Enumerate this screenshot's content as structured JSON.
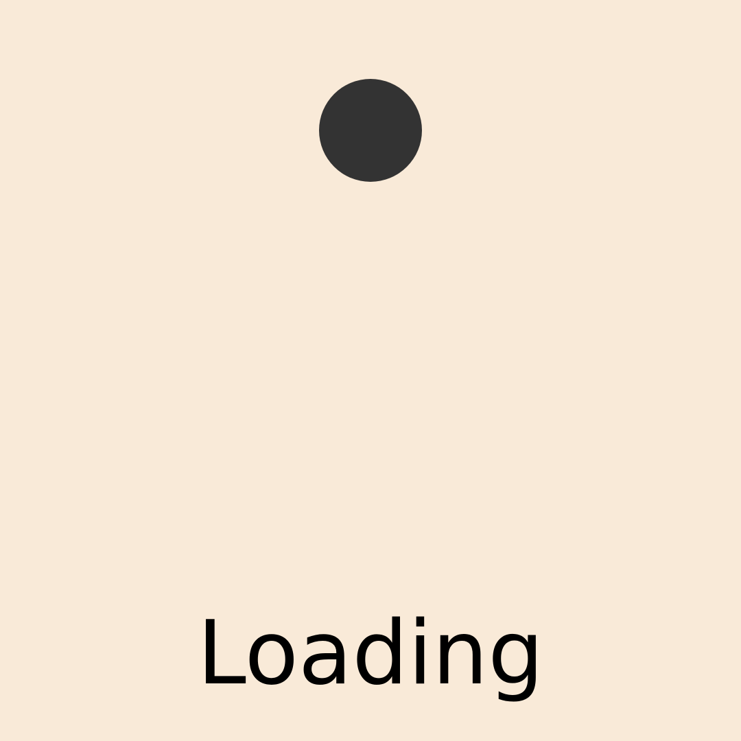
{
  "loading": {
    "label": "Loading",
    "indicator": "bouncing-dot"
  },
  "colors": {
    "background": "#f9ead8",
    "dot": "#333333",
    "text": "#000000"
  }
}
